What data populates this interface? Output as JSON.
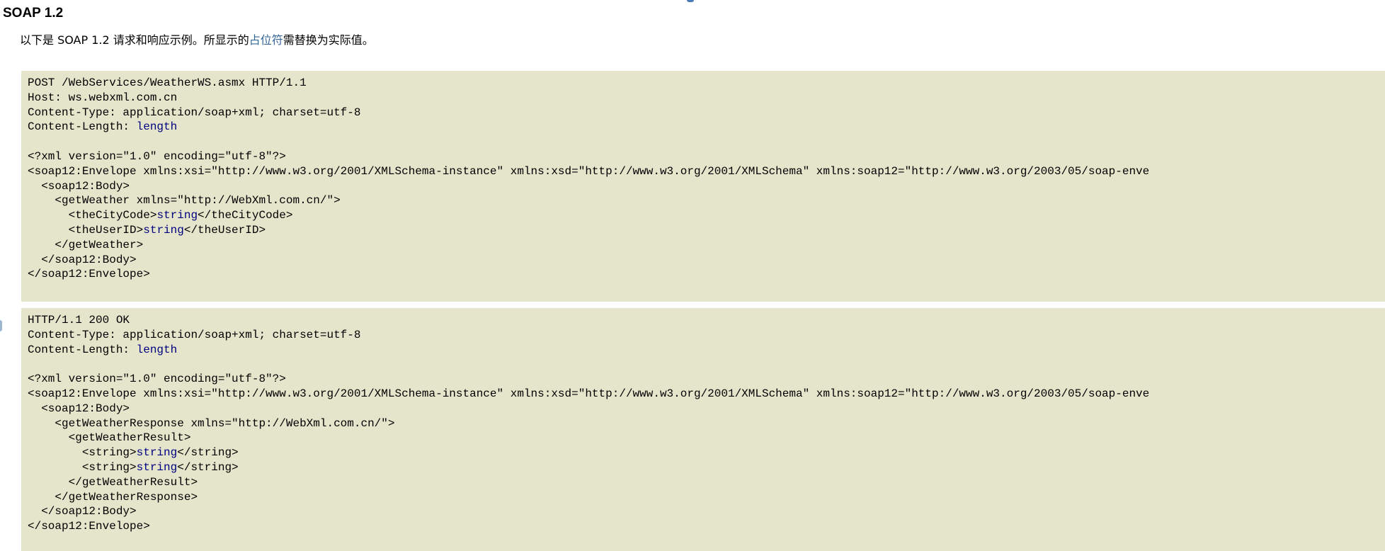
{
  "section": {
    "title": "SOAP 1.2"
  },
  "intro": {
    "prefix": "以下是 SOAP 1.2 请求和响应示例。所显示的",
    "link": "占位符",
    "suffix": "需替换为实际值。"
  },
  "request_lines": [
    [
      {
        "t": "POST /WebServices/WeatherWS.asmx HTTP/1.1"
      }
    ],
    [
      {
        "t": "Host: ws.webxml.com.cn"
      }
    ],
    [
      {
        "t": "Content-Type: application/soap+xml; charset=utf-8"
      }
    ],
    [
      {
        "t": "Content-Length: "
      },
      {
        "t": "length",
        "ph": true
      }
    ],
    [
      {
        "t": ""
      }
    ],
    [
      {
        "t": "<?xml version=\"1.0\" encoding=\"utf-8\"?>"
      }
    ],
    [
      {
        "t": "<soap12:Envelope xmlns:xsi=\"http://www.w3.org/2001/XMLSchema-instance\" xmlns:xsd=\"http://www.w3.org/2001/XMLSchema\" xmlns:soap12=\"http://www.w3.org/2003/05/soap-enve"
      }
    ],
    [
      {
        "t": "  <soap12:Body>"
      }
    ],
    [
      {
        "t": "    <getWeather xmlns=\"http://WebXml.com.cn/\">"
      }
    ],
    [
      {
        "t": "      <theCityCode>"
      },
      {
        "t": "string",
        "ph": true
      },
      {
        "t": "</theCityCode>"
      }
    ],
    [
      {
        "t": "      <theUserID>"
      },
      {
        "t": "string",
        "ph": true
      },
      {
        "t": "</theUserID>"
      }
    ],
    [
      {
        "t": "    </getWeather>"
      }
    ],
    [
      {
        "t": "  </soap12:Body>"
      }
    ],
    [
      {
        "t": "</soap12:Envelope>"
      }
    ]
  ],
  "response_lines": [
    [
      {
        "t": "HTTP/1.1 200 OK"
      }
    ],
    [
      {
        "t": "Content-Type: application/soap+xml; charset=utf-8"
      }
    ],
    [
      {
        "t": "Content-Length: "
      },
      {
        "t": "length",
        "ph": true
      }
    ],
    [
      {
        "t": ""
      }
    ],
    [
      {
        "t": "<?xml version=\"1.0\" encoding=\"utf-8\"?>"
      }
    ],
    [
      {
        "t": "<soap12:Envelope xmlns:xsi=\"http://www.w3.org/2001/XMLSchema-instance\" xmlns:xsd=\"http://www.w3.org/2001/XMLSchema\" xmlns:soap12=\"http://www.w3.org/2003/05/soap-enve"
      }
    ],
    [
      {
        "t": "  <soap12:Body>"
      }
    ],
    [
      {
        "t": "    <getWeatherResponse xmlns=\"http://WebXml.com.cn/\">"
      }
    ],
    [
      {
        "t": "      <getWeatherResult>"
      }
    ],
    [
      {
        "t": "        <string>"
      },
      {
        "t": "string",
        "ph": true
      },
      {
        "t": "</string>"
      }
    ],
    [
      {
        "t": "        <string>"
      },
      {
        "t": "string",
        "ph": true
      },
      {
        "t": "</string>"
      }
    ],
    [
      {
        "t": "      </getWeatherResult>"
      }
    ],
    [
      {
        "t": "    </getWeatherResponse>"
      }
    ],
    [
      {
        "t": "  </soap12:Body>"
      }
    ],
    [
      {
        "t": "</soap12:Envelope>"
      }
    ]
  ],
  "colors": {
    "code_background": "#e5e5cc",
    "placeholder_text": "#000080",
    "link": "#336699"
  }
}
